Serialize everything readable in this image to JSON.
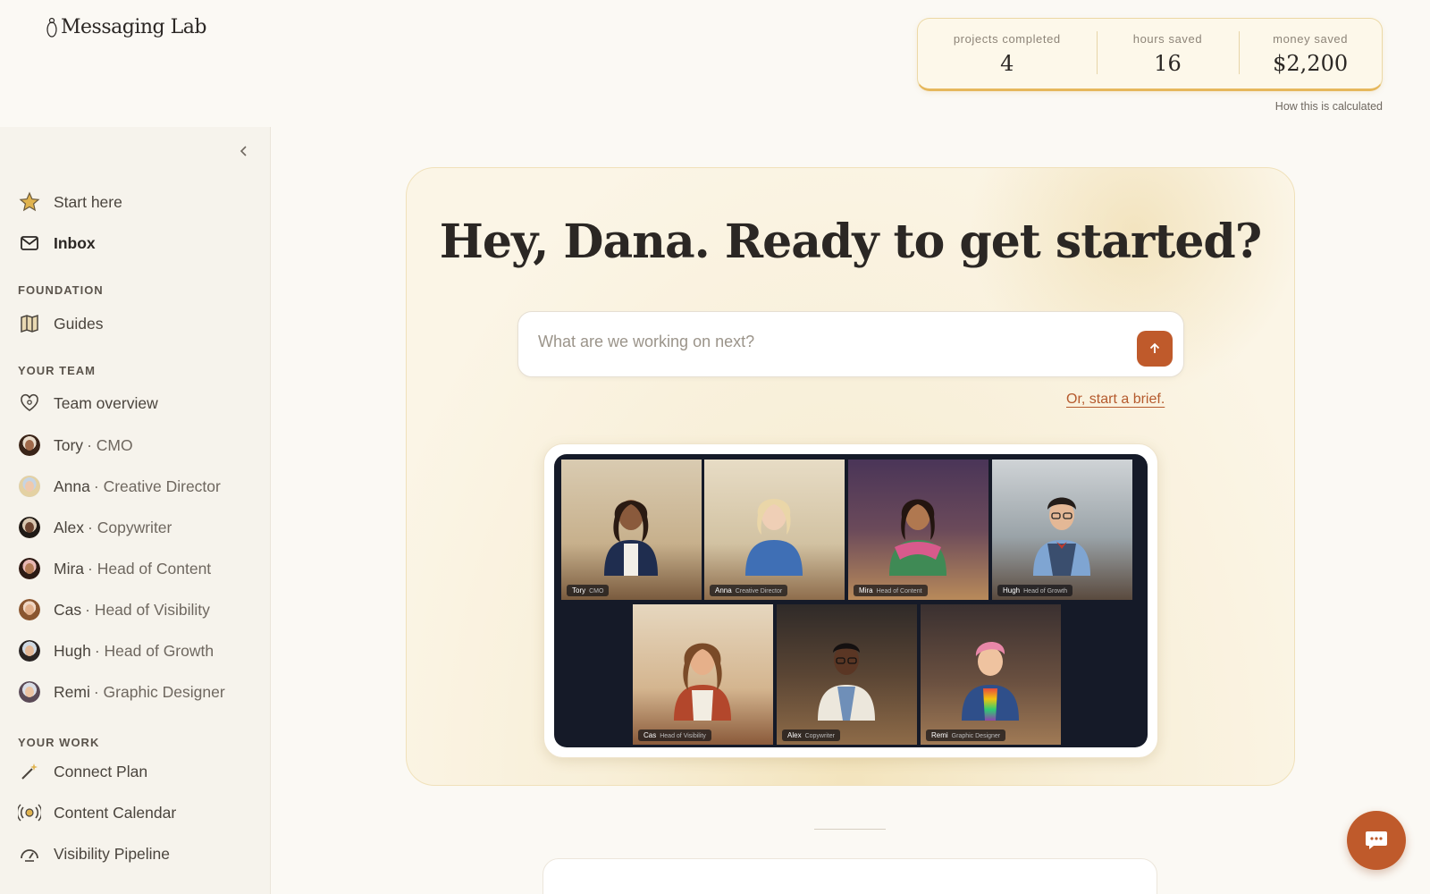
{
  "app": {
    "name": "Messaging Lab"
  },
  "stats": [
    {
      "label": "projects completed",
      "value": "4"
    },
    {
      "label": "hours saved",
      "value": "16"
    },
    {
      "label": "money saved",
      "value": "$2,200"
    }
  ],
  "stats_link": "How this is calculated",
  "sidebar": {
    "collapse_icon": "chevron-left-icon",
    "top_items": [
      {
        "label": "Start here",
        "icon": "star-icon"
      },
      {
        "label": "Inbox",
        "icon": "mail-icon"
      }
    ],
    "foundation_label": "FOUNDATION",
    "foundation_items": [
      {
        "label": "Guides",
        "icon": "map-icon"
      }
    ],
    "team_label": "YOUR TEAM",
    "team_overview": {
      "label": "Team overview",
      "icon": "heart-icon"
    },
    "team": [
      {
        "name": "Tory",
        "role": "· CMO"
      },
      {
        "name": "Anna",
        "role": "· Creative Director"
      },
      {
        "name": "Alex",
        "role": "· Copywriter"
      },
      {
        "name": "Mira",
        "role": "· Head of Content"
      },
      {
        "name": "Cas",
        "role": "· Head of Visibility"
      },
      {
        "name": "Hugh",
        "role": "· Head of Growth"
      },
      {
        "name": "Remi",
        "role": "· Graphic Designer"
      }
    ],
    "work_label": "YOUR WORK",
    "work_items": [
      {
        "label": "Connect Plan",
        "icon": "wand-icon"
      },
      {
        "label": "Content Calendar",
        "icon": "broadcast-icon"
      },
      {
        "label": "Visibility Pipeline",
        "icon": "gauge-icon"
      }
    ]
  },
  "hero": {
    "title": "Hey, Dana. Ready to get started?",
    "input_placeholder": "What are we working on next?",
    "brief_link": "Or, start a brief."
  },
  "video_tiles": [
    {
      "name": "Tory",
      "role": "CMO"
    },
    {
      "name": "Anna",
      "role": "Creative Director"
    },
    {
      "name": "Mira",
      "role": "Head of Content"
    },
    {
      "name": "Hugh",
      "role": "Head of Growth"
    },
    {
      "name": "Cas",
      "role": "Head of Visibility"
    },
    {
      "name": "Alex",
      "role": "Copywriter"
    },
    {
      "name": "Remi",
      "role": "Graphic Designer"
    }
  ],
  "colors": {
    "accent": "#bf5a2b",
    "gold": "#e6b85c",
    "background": "#fbf9f4"
  }
}
